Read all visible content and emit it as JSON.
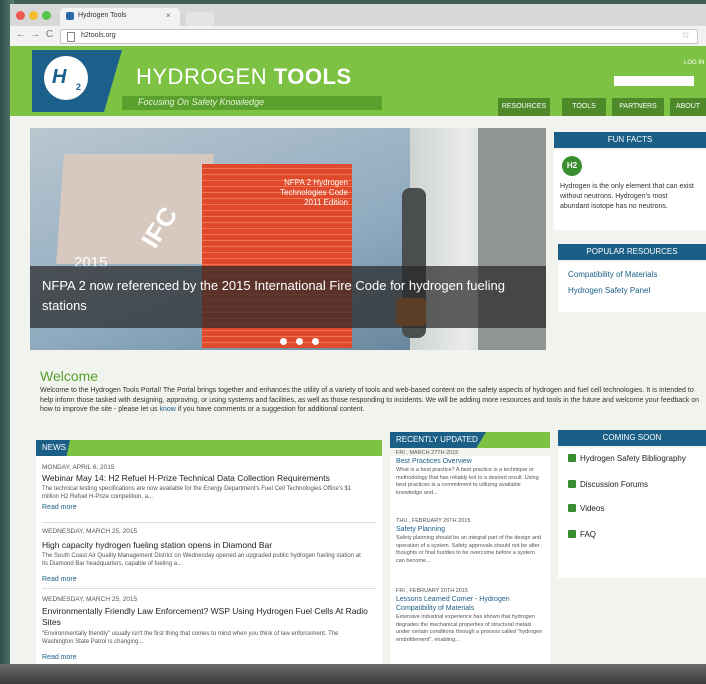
{
  "browser": {
    "tab_title": "Hydrogen Tools",
    "tab_close": "×",
    "url": "h2tools.org",
    "back": "←",
    "forward": "→",
    "reload": "C",
    "star": "☆"
  },
  "header": {
    "logo_text": "H",
    "logo_sub": "2",
    "title_light": "HYDROGEN ",
    "title_bold": "TOOLS",
    "tagline": "Focusing On Safety Knowledge",
    "login": "LOG IN",
    "nav": [
      "RESOURCES",
      "TOOLS",
      "PARTNERS",
      "ABOUT"
    ]
  },
  "hero": {
    "book_grey_text": "IFC",
    "book_year": "2015",
    "book_red_text": "NFPA 2 Hydrogen Technologies Code 2011 Edition",
    "caption": "NFPA 2 now referenced by the 2015 International Fire Code for hydrogen fueling stations"
  },
  "fun_facts": {
    "heading": "FUN FACTS",
    "icon_label": "H2",
    "text": "Hydrogen is the only element that can exist without neutrons. Hydrogen's most abundant isotope has no neutrons."
  },
  "popular": {
    "heading": "POPULAR RESOURCES",
    "links": [
      "Compatibility of Materials",
      "Hydrogen Safety Panel"
    ]
  },
  "welcome": {
    "title": "Welcome",
    "text_before": "Welcome to the Hydrogen Tools Portal! The Portal brings together and enhances the utility of a variety of tools and web-based content on the safety aspects of hydrogen and fuel cell technologies. It is intended to help inform those tasked with designing, approving, or using systems and facilities, as well as those responding to incidents. We will be adding more resources and tools in the future and welcome your feedback on how to improve the site - please let us ",
    "link": "know",
    "text_after": " if you have comments or a suggestion for additional content."
  },
  "news": {
    "heading": "NEWS",
    "items": [
      {
        "date": "MONDAY, APRIL 6, 2015",
        "title": "Webinar May 14: H2 Refuel H-Prize Technical Data Collection Requirements",
        "desc": "The technical testing specifications are now available for the Energy Department's Fuel Cell Technologies Office's $1 million H2 Refuel H-Prize competition, a...",
        "more": "Read more"
      },
      {
        "date": "WEDNESDAY, MARCH 25, 2015",
        "title": "High capacity hydrogen fueling station opens in Diamond Bar",
        "desc": "The South Coast Air Quality Management District on Wednesday opened an upgraded public hydrogen fueling station at its Diamond Bar headquarters, capable of fueling a...",
        "more": "Read more"
      },
      {
        "date": "WEDNESDAY, MARCH 25, 2015",
        "title": "Environmentally Friendly Law Enforcement? WSP Using Hydrogen Fuel Cells At Radio Sites",
        "desc": "\"Environmentally friendly\" usually isn't the first thing that comes to mind when you think of law enforcement. The Washington State Patrol is changing...",
        "more": "Read more"
      }
    ]
  },
  "recent": {
    "heading": "RECENTLY UPDATED",
    "items": [
      {
        "date": "FRI , MARCH 27TH 2015",
        "title": "Best Practices Overview",
        "desc": "What is a best practice? A best practice is a technique or methodology that has reliably led to a desired result. Using best practices is a commitment to utilizing available knowledge and..."
      },
      {
        "date": "THU , FEBRUARY 26TH 2015",
        "title": "Safety Planning",
        "desc": "Safety planning should be an integral part of the design and operation of a system. Safety approvals should not be after thoughts or final hurdles to be overcome before a system can become..."
      },
      {
        "date": "FRI , FEBRUARY 20TH 2015",
        "title": "Lessons Learned Corner - Hydrogen Compatibility of Materials",
        "desc": "Extensive industrial experience has shown that hydrogen degrades the mechanical properties of structural metals under certain conditions through a process called \"hydrogen embrittlement\", enabling..."
      }
    ]
  },
  "coming": {
    "heading": "COMING SOON",
    "items": [
      "Hydrogen Safety Bibliography",
      "Discussion Forums",
      "Videos",
      "FAQ"
    ]
  },
  "colors": {
    "green": "#7dc243",
    "blue": "#1b5e86",
    "dark_green": "#4e8a2a"
  }
}
